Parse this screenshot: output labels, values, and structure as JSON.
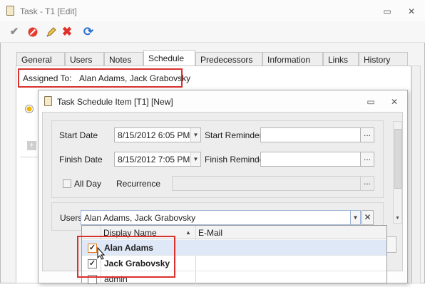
{
  "window": {
    "title": "Task - T1 [Edit]"
  },
  "toolbar": {
    "icons": [
      "checkmark-icon",
      "cancel-circle-icon",
      "edit-pencil-icon",
      "delete-x-icon",
      "refresh-icon"
    ]
  },
  "tabs": [
    {
      "label": "General"
    },
    {
      "label": "Users"
    },
    {
      "label": "Notes"
    },
    {
      "label": "Schedule"
    },
    {
      "label": "Predecessors"
    },
    {
      "label": "Information"
    },
    {
      "label": "Links"
    },
    {
      "label": "History"
    }
  ],
  "assigned": {
    "label": "Assigned To:",
    "value": "Alan Adams, Jack Grabovsky"
  },
  "dialog": {
    "title": "Task Schedule Item [T1] [New]",
    "start_date_label": "Start Date",
    "start_date_value": "8/15/2012 6:05 PM",
    "start_reminder_label": "Start Reminder",
    "finish_date_label": "Finish Date",
    "finish_date_value": "8/15/2012 7:05 PM",
    "finish_reminder_label": "Finish Reminder",
    "all_day_label": "All Day",
    "recurrence_label": "Recurrence",
    "users_label": "Users",
    "users_value": "Alan Adams, Jack Grabovsky",
    "ellipsis": "...",
    "clear": "✕"
  },
  "grid": {
    "columns": [
      "Display Name",
      "E-Mail"
    ],
    "rows": [
      {
        "name": "Alan Adams",
        "checked": true
      },
      {
        "name": "Jack Grabovsky",
        "checked": true
      },
      {
        "name": "admin",
        "checked": false
      }
    ]
  },
  "colors": {
    "highlight": "#d9312e",
    "selected_row": "#dfe8f6"
  }
}
